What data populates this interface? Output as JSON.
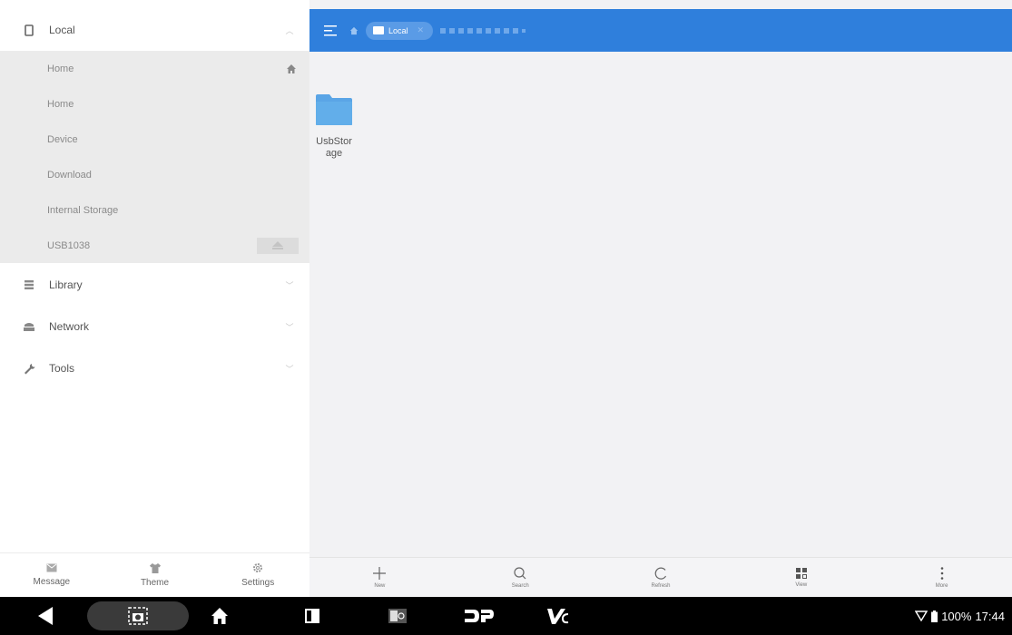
{
  "sidebar": {
    "groups": [
      {
        "label": "Local",
        "icon": "phone-icon"
      },
      {
        "label": "Library",
        "icon": "library-icon"
      },
      {
        "label": "Network",
        "icon": "network-icon"
      },
      {
        "label": "Tools",
        "icon": "wrench-icon"
      }
    ],
    "local_items": [
      {
        "label": "Home"
      },
      {
        "label": "Home"
      },
      {
        "label": "Device"
      },
      {
        "label": "Download"
      },
      {
        "label": "Internal Storage"
      },
      {
        "label": "USB1038"
      }
    ],
    "bottom": [
      {
        "label": "Message",
        "icon": "message-icon"
      },
      {
        "label": "Theme",
        "icon": "shirt-icon"
      },
      {
        "label": "Settings",
        "icon": "gear-icon"
      }
    ]
  },
  "topbar": {
    "crumb": "Local",
    "accent": "#2f7fdc"
  },
  "content": {
    "folders": [
      {
        "name": "UsbStorage"
      }
    ],
    "folder_color": "#5aa5e6"
  },
  "bottombar": {
    "actions": [
      {
        "label": "New",
        "icon": "plus-icon"
      },
      {
        "label": "Search",
        "icon": "search-icon"
      },
      {
        "label": "Refresh",
        "icon": "refresh-icon"
      },
      {
        "label": "View",
        "icon": "grid-view-icon"
      },
      {
        "label": "More",
        "icon": "more-vertical-icon"
      }
    ]
  },
  "status": {
    "battery": "100%",
    "time": "17:44"
  }
}
